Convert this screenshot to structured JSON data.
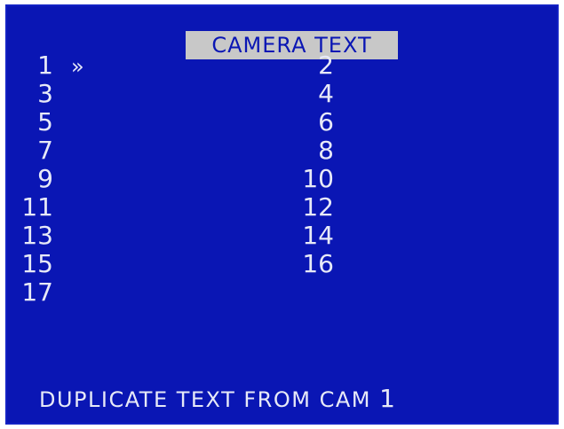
{
  "title": "CAMERA TEXT",
  "cursor": "»",
  "cameras_left": [
    "1",
    "3",
    "5",
    "7",
    "9",
    "11",
    "13",
    "15",
    "17"
  ],
  "cameras_right": [
    "2",
    "4",
    "6",
    "8",
    "10",
    "12",
    "14",
    "16"
  ],
  "footer": {
    "label": "DUPLICATE TEXT FROM CAM",
    "value": "1"
  },
  "colors": {
    "background": "#0a16b4",
    "text": "#e7e9f7",
    "title_bg": "#c8c8c8"
  }
}
